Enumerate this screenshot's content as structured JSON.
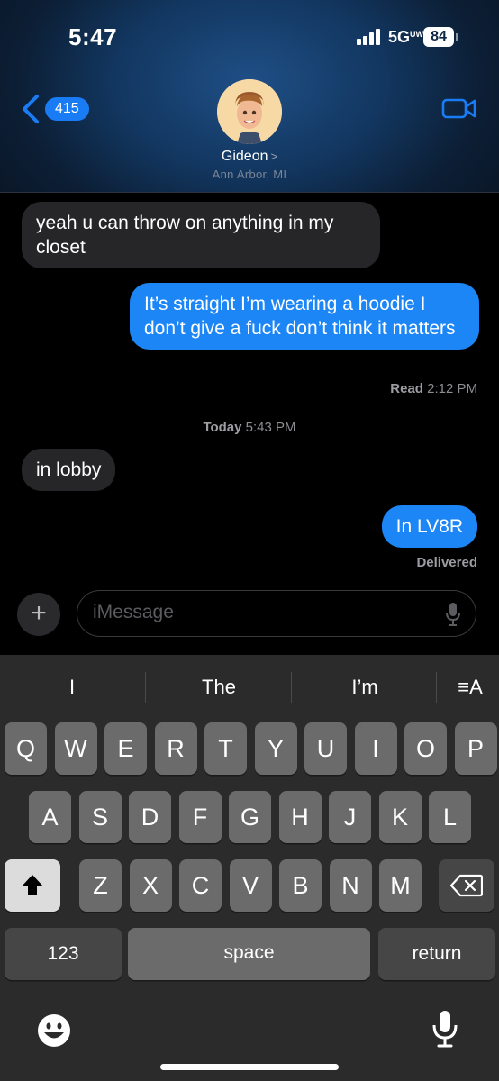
{
  "status": {
    "time": "5:47",
    "network": "5G",
    "network_sup": "UW",
    "battery": "84"
  },
  "header": {
    "back_count": "415",
    "contact_name": "Gideon",
    "contact_location": "Ann Arbor, MI"
  },
  "messages": [
    {
      "direction": "incoming",
      "text": "yeah u can throw on anything in my closet"
    },
    {
      "direction": "outgoing",
      "text": "It’s straight  I’m wearing a hoodie I don’t give a fuck don’t think it matters"
    },
    {
      "direction": "incoming",
      "text": "in lobby"
    },
    {
      "direction": "outgoing",
      "text": "In LV8R"
    }
  ],
  "receipts": {
    "read_label": "Read",
    "read_time": "2:12 PM",
    "divider_day": "Today",
    "divider_time": "5:43 PM",
    "delivered": "Delivered"
  },
  "composer": {
    "placeholder": "iMessage",
    "plus": "+"
  },
  "keyboard": {
    "suggestions": [
      "I",
      "The",
      "I’m"
    ],
    "format_label": "≡A",
    "row1": [
      "Q",
      "W",
      "E",
      "R",
      "T",
      "Y",
      "U",
      "I",
      "O",
      "P"
    ],
    "row2": [
      "A",
      "S",
      "D",
      "F",
      "G",
      "H",
      "J",
      "K",
      "L"
    ],
    "row3": [
      "Z",
      "X",
      "C",
      "V",
      "B",
      "N",
      "M"
    ],
    "numbers_label": "123",
    "space_label": "space",
    "return_label": "return"
  },
  "icons": [
    "back-chevron-icon",
    "video-call-icon",
    "microphone-icon",
    "shift-icon",
    "delete-icon",
    "emoji-icon",
    "dictation-icon"
  ]
}
